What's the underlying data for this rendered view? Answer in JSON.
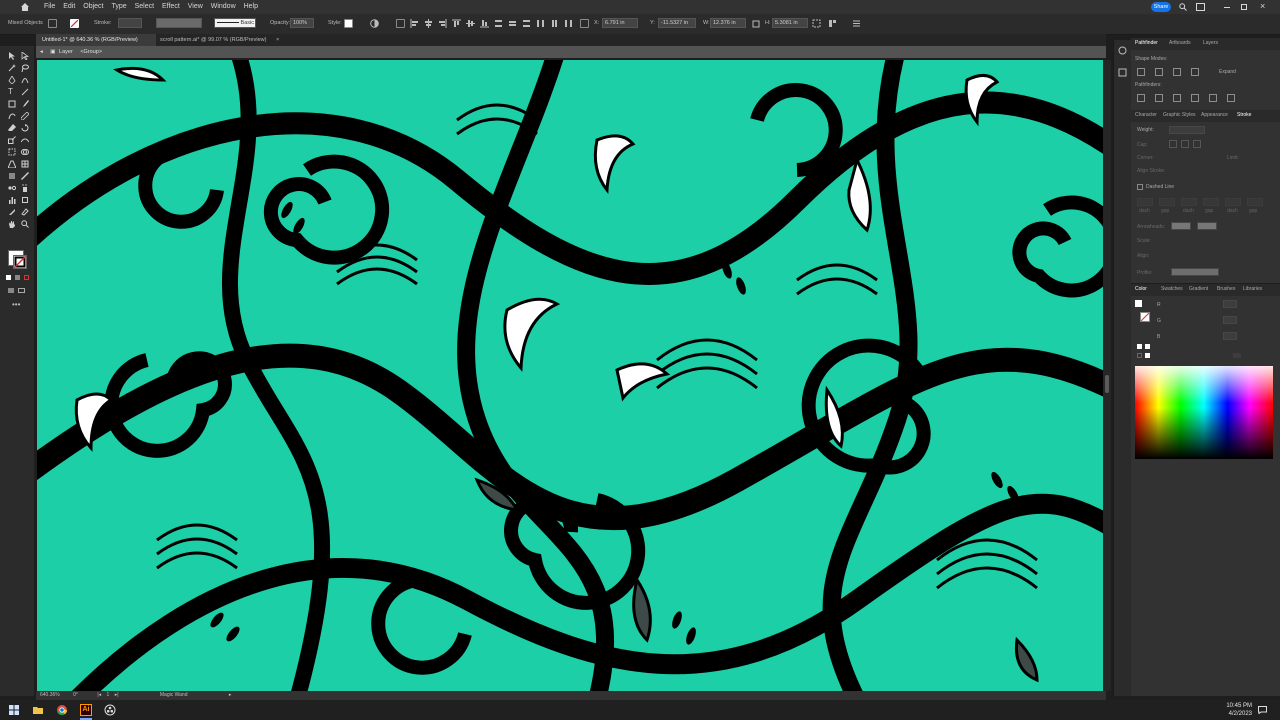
{
  "menu": [
    "File",
    "Edit",
    "Object",
    "Type",
    "Select",
    "Effect",
    "View",
    "Window",
    "Help"
  ],
  "share_label": "Share",
  "controlbar": {
    "selection_label": "Mixed Objects",
    "stroke_label": "Stroke:",
    "brush_label": "Basic",
    "opacity_label": "Opacity:",
    "opacity_value": "100%",
    "style_label": "Style:",
    "x_label": "X:",
    "x_value": "6.791 in",
    "y_label": "Y:",
    "y_value": "-11.5327 in",
    "w_label": "W:",
    "w_value": "12.376 in",
    "h_label": "H:",
    "h_value": "5.3081 in"
  },
  "tabs": [
    {
      "label": "Untitled-1* @ 640.36 % (RGB/Preview)",
      "close": "×"
    },
    {
      "label": "scroll pattern.ai* @ 99.07 % (RGB/Preview)",
      "close": "×"
    }
  ],
  "breadcrumb": {
    "layer": "Layer",
    "group": "<Group>"
  },
  "status": {
    "zoom": "640.36%",
    "rotation": "0°",
    "page": "1",
    "tool": "Magic Wand"
  },
  "panelA": {
    "tabs": [
      "Pathfinder",
      "Artboards",
      "Layers"
    ],
    "shape_modes": "Shape Modes:",
    "expand": "Expand",
    "pathfinders": "Pathfinders:",
    "sub_tabs": [
      "Character",
      "Graphic Styles",
      "Appearance",
      "Stroke"
    ],
    "weight_label": "Weight:",
    "cap": "Cap:",
    "corner": "Corner:",
    "limit": "Limit:",
    "align_stroke": "Align Stroke:",
    "dashed_line": "Dashed Line",
    "dash_labels": [
      "dash",
      "gap",
      "dash",
      "gap",
      "dash",
      "gap"
    ],
    "arrowheads": "Arrowheads:",
    "scale": "Scale:",
    "align": "Align:",
    "profile": "Profile:"
  },
  "panelB": {
    "tabs": [
      "Color",
      "Swatches",
      "Gradient",
      "Brushes",
      "Libraries"
    ],
    "channels": [
      "R",
      "G",
      "B"
    ]
  },
  "taskbar": {
    "time": "10:45 PM",
    "date": "4/2/2023"
  },
  "colors": {
    "canvas": "#1dcfa6",
    "ink": "#000000",
    "accent": "#1473e6"
  }
}
